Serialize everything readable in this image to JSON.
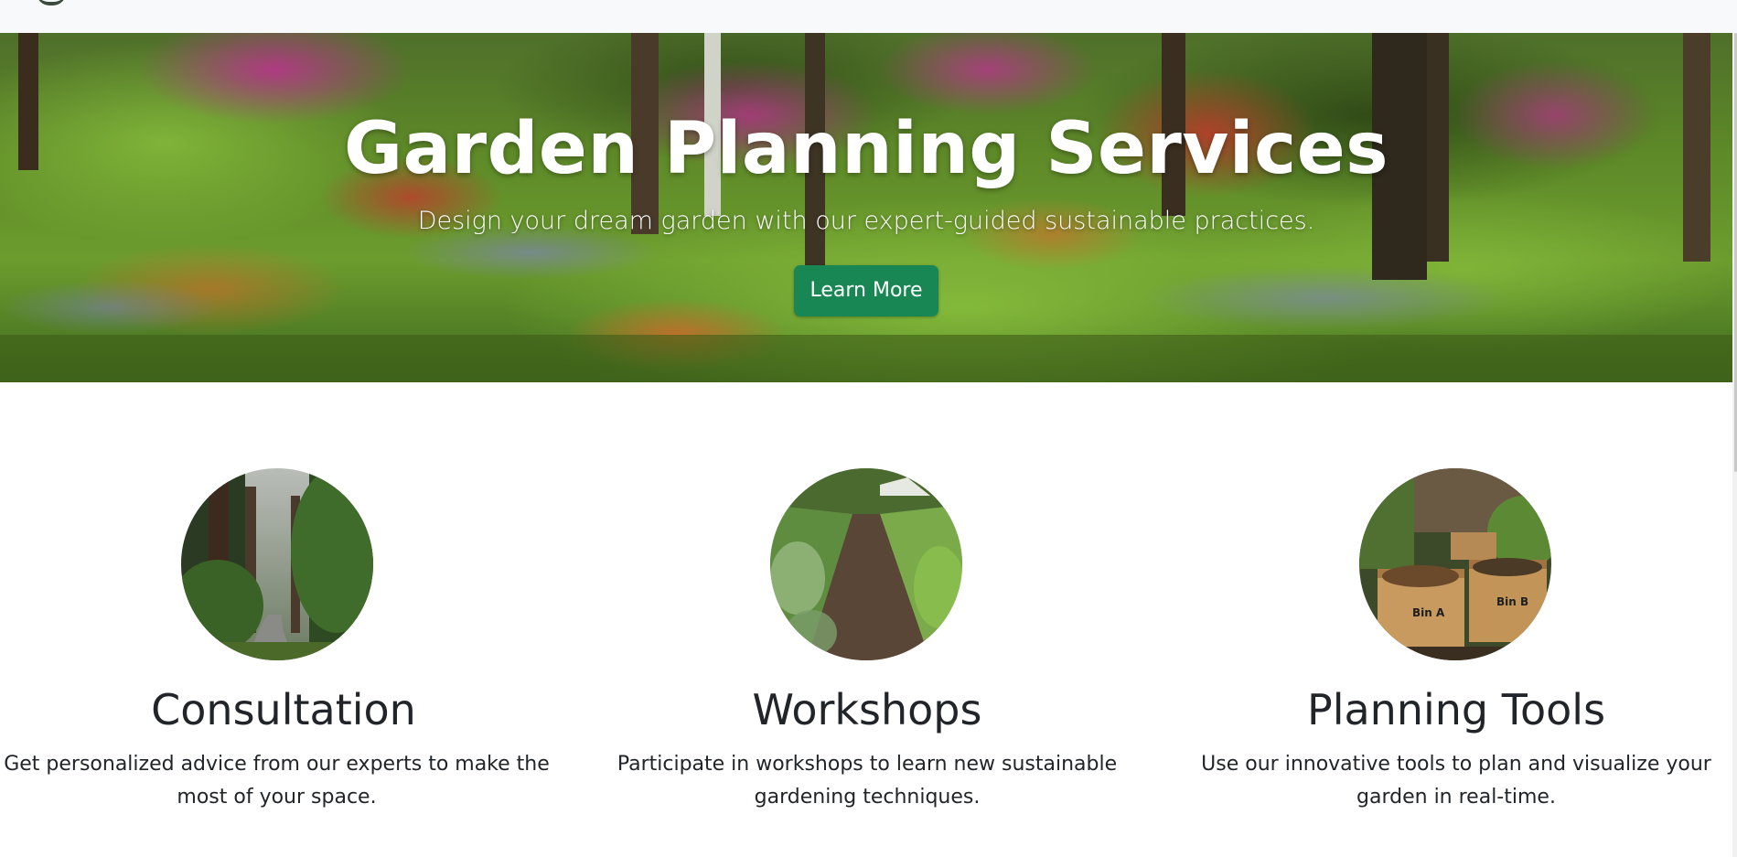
{
  "hero": {
    "title": "Garden Planning Services",
    "subtitle": "Design your dream garden with our expert-guided sustainable practices.",
    "button_label": "Learn More",
    "accent_color": "#198754"
  },
  "features": [
    {
      "title": "Consultation",
      "text_line1": "Get personalized advice from our experts to make the",
      "text_line2": "most of your space.",
      "image": "forest-path-photo"
    },
    {
      "title": "Workshops",
      "text_line1": "Participate in workshops to learn new sustainable",
      "text_line2": "gardening techniques.",
      "image": "vegetable-garden-rows-photo"
    },
    {
      "title": "Planning Tools",
      "text_line1": "Use our innovative tools to plan and visualize your",
      "text_line2": "garden in real-time.",
      "image": "compost-bins-photo",
      "bin_labels": [
        "Bin A",
        "Bin B"
      ]
    }
  ]
}
